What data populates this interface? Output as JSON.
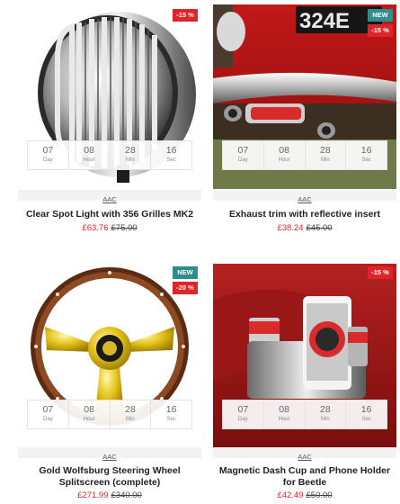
{
  "countdown_labels": {
    "day": "Day",
    "hour": "Hour",
    "min": "Min",
    "sec": "Sec"
  },
  "products": [
    {
      "badges": [
        "-15 %"
      ],
      "countdown": {
        "days": "07",
        "hours": "08",
        "mins": "28",
        "secs": "16"
      },
      "brand": "AAC",
      "title": "Clear Spot Light with 356 Grilles MK2",
      "price": "£63.76",
      "old_price": "£75.00"
    },
    {
      "badges": [
        "NEW",
        "-15 %"
      ],
      "countdown": {
        "days": "07",
        "hours": "08",
        "mins": "28",
        "secs": "16"
      },
      "brand": "AAC",
      "title": "Exhaust trim with reflective insert",
      "price": "£38.24",
      "old_price": "£45.00",
      "plate_text": "324E"
    },
    {
      "badges": [
        "NEW",
        "-20 %"
      ],
      "countdown": {
        "days": "07",
        "hours": "08",
        "mins": "28",
        "secs": "16"
      },
      "brand": "AAC",
      "title_line1": "Gold Wolfsburg Steering Wheel",
      "title_line2": "Splitscreen (complete)",
      "price": "£271.99",
      "old_price": "£340.00"
    },
    {
      "badges": [
        "-15 %"
      ],
      "countdown": {
        "days": "07",
        "hours": "08",
        "mins": "28",
        "secs": "16"
      },
      "brand": "AAC",
      "title_line1": "Magnetic Dash Cup and Phone Holder",
      "title_line2": "for Beetle",
      "price": "£42.49",
      "old_price": "£50.00"
    }
  ]
}
